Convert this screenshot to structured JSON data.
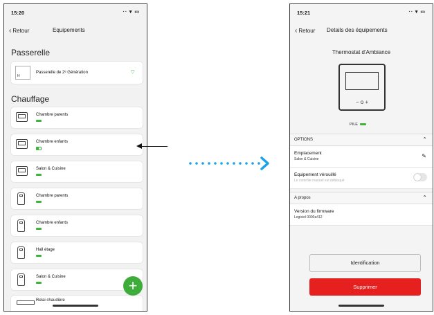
{
  "left": {
    "time": "15:20",
    "status_icons": "‧‧ ▾ ▭",
    "back_label": "Retour",
    "title": "Equipements",
    "section_gateway": "Passerelle",
    "gateway_label": "Passerelle de 2ᵉ Génération",
    "gateway_icon_text": "H",
    "section_heating": "Chauffage",
    "devices": [
      {
        "label": "Chambre parents",
        "icon": "thermostat-icon",
        "battery": "full"
      },
      {
        "label": "Chambre enfants",
        "icon": "thermostat-icon",
        "battery": "low"
      },
      {
        "label": "Salon & Cuisine",
        "icon": "thermostat-icon",
        "battery": "full"
      },
      {
        "label": "Chambre parents",
        "icon": "valve-icon",
        "battery": "full"
      },
      {
        "label": "Chambre enfants",
        "icon": "valve-icon",
        "battery": "full"
      },
      {
        "label": "Hall étage",
        "icon": "valve-icon",
        "battery": "full"
      },
      {
        "label": "Salon & Cuisine",
        "icon": "valve-icon",
        "battery": "full"
      },
      {
        "label": "Relai chaudière",
        "icon": "relay-icon",
        "battery": "none"
      }
    ],
    "fab_label": "+"
  },
  "right": {
    "time": "15:21",
    "status_icons": "‧‧ ▾ ▭",
    "back_label": "Retour",
    "title": "Details des équipements",
    "device_name": "Thermostat d'Ambiance",
    "thermostat_controls": "−  o  +",
    "pile_label": "PILE",
    "options_header": "OPTIONS",
    "location_label": "Emplacement",
    "location_value": "Salon & Cuisine",
    "lock_label": "Equipement vérouillé",
    "lock_sub": "Le contrôle manuel est débloqué",
    "lock_enabled": false,
    "about_header": "A propos",
    "firmware_label": "Version du firmware",
    "firmware_value": "Logiciel 0000a412",
    "identify_button": "Identification",
    "delete_button": "Supprimer"
  },
  "colors": {
    "accent_green": "#3eac3b",
    "delete_red": "#e5201e",
    "arrow_blue": "#1aa3e8"
  }
}
